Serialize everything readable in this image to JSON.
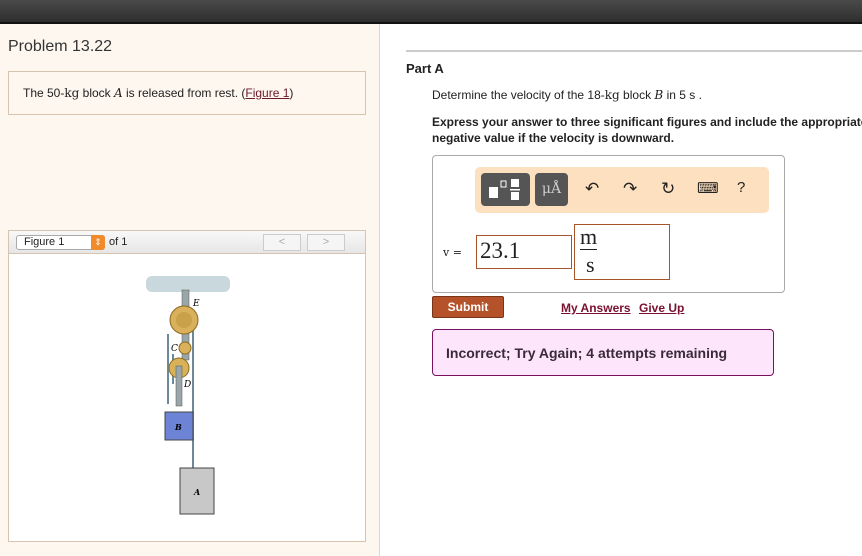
{
  "problem": {
    "title": "Problem 13.22",
    "text_pre": "The 50-",
    "text_unit": "kg",
    "text_mid": " block ",
    "text_var": "A",
    "text_post": " is released from rest. (",
    "figure_link": "Figure 1",
    "text_close": ")"
  },
  "figure": {
    "selector": "Figure 1",
    "of": "of 1",
    "prev": "<",
    "next": ">",
    "labels": {
      "e": "E",
      "c": "C",
      "d": "D",
      "b": "B",
      "a": "A"
    }
  },
  "part": {
    "title": "Part A",
    "q_pre": "Determine the velocity of the 18-",
    "q_unit": "kg",
    "q_mid": " block ",
    "q_var": "B",
    "q_post": " in 5  s .",
    "instruction_1": "Express your answer to three significant figures and include the appropriate units. Enter",
    "instruction_2": "negative value if the velocity is downward."
  },
  "toolbar": {
    "units_label": "μÅ",
    "undo": "↶",
    "redo": "↷",
    "reset": "↻",
    "keyboard": "⌨",
    "help": "?"
  },
  "answer": {
    "var_label": "v =",
    "value": "23.1",
    "unit_num": "m",
    "unit_den": "s"
  },
  "actions": {
    "submit": "Submit",
    "my_answers": "My Answers",
    "give_up": "Give Up"
  },
  "feedback": "Incorrect; Try Again; 4 attempts remaining"
}
